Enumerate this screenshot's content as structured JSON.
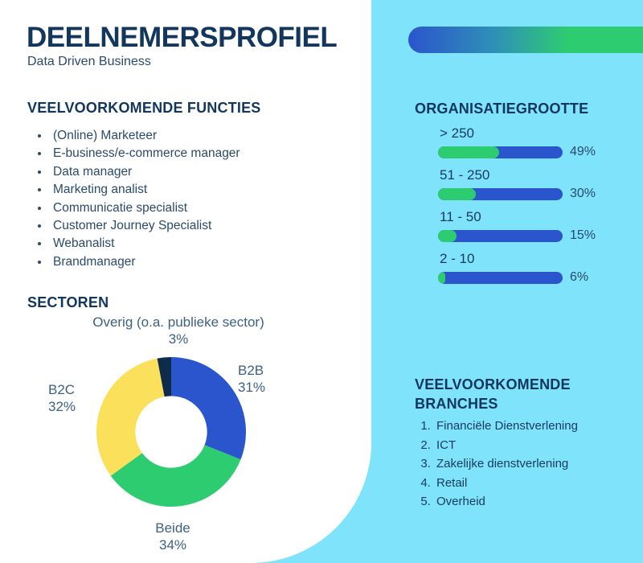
{
  "header": {
    "title": "DEELNEMERSPROFIEL",
    "subtitle": "Data Driven Business"
  },
  "functies": {
    "heading": "VEELVOORKOMENDE FUNCTIES",
    "items": [
      "(Online) Marketeer",
      "E-business/e-commerce manager",
      "Data manager",
      "Marketing analist",
      "Communicatie specialist",
      "Customer Journey Specialist",
      "Webanalist",
      "Brandmanager"
    ]
  },
  "branches": {
    "heading": "VEELVOORKOMENDE BRANCHES",
    "items": [
      "Financiële Dienstverlening",
      "ICT",
      "Zakelijke dienstverlening",
      "Retail",
      "Overheid"
    ]
  },
  "organisatiegrootte": {
    "heading": "ORGANISATIEGROOTTE"
  },
  "sectoren": {
    "heading": "SECTOREN",
    "labels": {
      "overig": "Overig (o.a. publieke sector)",
      "overig_pct": "3%",
      "b2b": "B2B",
      "b2b_pct": "31%",
      "b2c": "B2C",
      "b2c_pct": "32%",
      "beide": "Beide",
      "beide_pct": "34%"
    }
  },
  "colors": {
    "panel_blue": "#7fe3fb",
    "navy": "#12365c",
    "bar_blue": "#2b55cc",
    "green": "#2ecc71",
    "yellow": "#fbe05c",
    "dark_navy": "#0f2b4a"
  },
  "chart_data": [
    {
      "type": "bar",
      "title": "ORGANISATIEGROOTTE",
      "orientation": "horizontal",
      "categories": [
        "> 250",
        "51 - 250",
        "11 - 50",
        "2 - 10"
      ],
      "values": [
        49,
        30,
        15,
        6
      ],
      "value_labels": [
        "49%",
        "30%",
        "15%",
        "6%"
      ],
      "unit": "%",
      "xlim": [
        0,
        100
      ],
      "grid": false,
      "legend": false,
      "track_color": "#2b55cc",
      "fill_color": "#2ecc71"
    },
    {
      "type": "pie",
      "variant": "donut",
      "title": "SECTOREN",
      "categories": [
        "B2B",
        "Beide",
        "B2C",
        "Overig (o.a. publieke sector)"
      ],
      "values": [
        31,
        34,
        32,
        3
      ],
      "value_labels": [
        "31%",
        "34%",
        "32%",
        "3%"
      ],
      "colors": [
        "#2b55cc",
        "#2ecc71",
        "#fbe05c",
        "#0f2b4a"
      ],
      "start_angle_deg": 0,
      "direction": "clockwise",
      "inner_radius_ratio": 0.48,
      "legend": "labels-around-chart"
    }
  ]
}
